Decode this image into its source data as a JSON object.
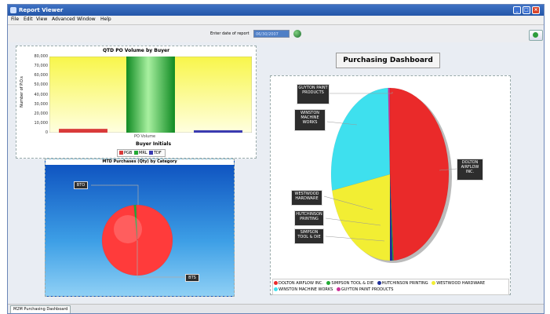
{
  "window": {
    "title": "Report Viewer"
  },
  "menu": [
    "File",
    "Edit",
    "View",
    "Advanced",
    "Window",
    "Help"
  ],
  "toolbar": {
    "date_label": "Enter date of report",
    "date_value": "06/30/2007"
  },
  "dashboard": {
    "title": "Purchasing Dashboard"
  },
  "qtd_chart": {
    "chart_data": {
      "type": "bar",
      "title": "QTD PO Volume by Buyer",
      "ylabel": "Number of P.O.s",
      "xlabel": "Buyer Initials",
      "category_label": "PO Volume",
      "y_ticks": [
        "80,000",
        "70,000",
        "60,000",
        "50,000",
        "40,000",
        "30,000",
        "20,000",
        "10,000",
        "0"
      ],
      "ylim": [
        0,
        80000
      ],
      "series": [
        {
          "name": "PGB",
          "values": [
            4000
          ],
          "color": "#d93a3a"
        },
        {
          "name": "MRL",
          "values": [
            80000
          ],
          "color": "#22aa33"
        },
        {
          "name": "TDF",
          "values": [
            2500
          ],
          "color": "#3a3ab0"
        }
      ]
    }
  },
  "mtd_chart": {
    "chart_data": {
      "type": "pie",
      "title": "MTD Purchases (Qty) by Category",
      "slices": [
        {
          "label": "BTS",
          "value": 99,
          "color": "#ff3b3b"
        },
        {
          "label": "BTO",
          "value": 1,
          "color": "#22aa33"
        }
      ]
    }
  },
  "vendor_chart": {
    "chart_data": {
      "type": "pie",
      "slices": [
        {
          "label": "DOLTON AIRFLOW INC.",
          "value": 49,
          "color": "#ea2a2a"
        },
        {
          "label": "SIMPSON TOOL & DIE",
          "value": 0.3,
          "color": "#22aa33"
        },
        {
          "label": "HUTCHINSON PRINTING",
          "value": 0.7,
          "color": "#1f2f9a"
        },
        {
          "label": "WESTWOOD HARDWARE",
          "value": 22,
          "color": "#f2ee33"
        },
        {
          "label": "WINSTON MACHINE WORKS",
          "value": 27.5,
          "color": "#3ee0ee"
        },
        {
          "label": "GUYTON PAINT PRODUCTS",
          "value": 0.5,
          "color": "#cc3399"
        }
      ]
    }
  },
  "callouts": {
    "guyton": "GUYTON PAINT PRODUCTS",
    "winston": "WINSTON MACHINE WORKS",
    "dolton": "DOLTON AIRFLOW INC.",
    "westwood": "WESTWOOD HARDWARE",
    "hutchinson": "HUTCHINSON PRINTING",
    "simpson": "SIMPSON TOOL & DIE",
    "bto": "BTO",
    "bts": "BTS"
  },
  "tab": {
    "label": "M2M Purchasing Dashboard"
  }
}
